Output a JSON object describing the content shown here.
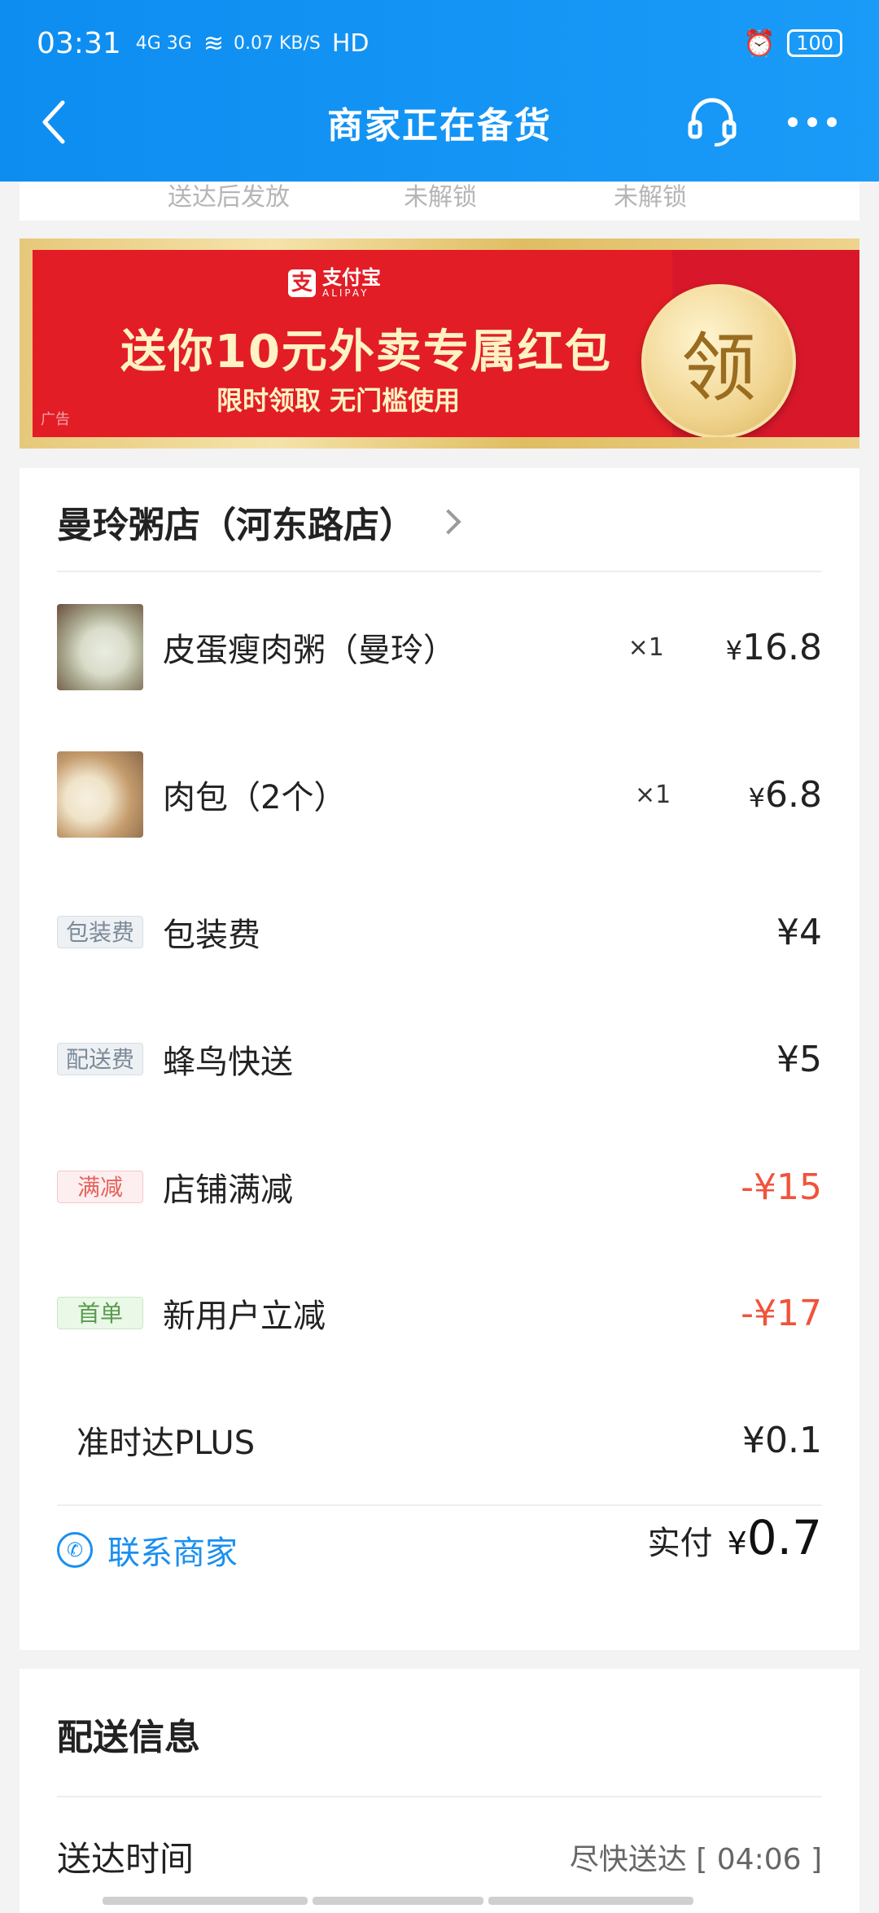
{
  "status_bar": {
    "time": "03:31",
    "signal": "4G 3G",
    "net_speed": "0.07 KB/S",
    "hd": "HD",
    "battery": "100"
  },
  "nav": {
    "title": "商家正在备货"
  },
  "unlock_strip": {
    "items": [
      "送达后发放",
      "未解锁",
      "未解锁"
    ]
  },
  "ad": {
    "brand": "支付宝",
    "brand_sub": "ALIPAY",
    "headline": "送你10元外卖专属红包",
    "subline": "限时领取 无门槛使用",
    "tag": "广告",
    "coin": "领"
  },
  "order": {
    "shop_name": "曼玲粥店（河东路店）",
    "items": [
      {
        "name": "皮蛋瘦肉粥（曼玲）",
        "qty": "×1",
        "price": "16.8"
      },
      {
        "name": "肉包（2个）",
        "qty": "×1",
        "price": "6.8"
      }
    ],
    "fees": [
      {
        "badge": "包装费",
        "name": "包装费",
        "price": "¥4",
        "style": "gray"
      },
      {
        "badge": "配送费",
        "name": "蜂鸟快送",
        "price": "¥5",
        "style": "gray"
      },
      {
        "badge": "满减",
        "name": "店铺满减",
        "price": "-¥15",
        "style": "red"
      },
      {
        "badge": "首单",
        "name": "新用户立减",
        "price": "-¥17",
        "style": "green"
      }
    ],
    "plus": {
      "name": "准时达PLUS",
      "price": "¥0.1"
    },
    "contact": "联系商家",
    "paid_label": "实付",
    "paid_value": "0.7",
    "yen": "¥"
  },
  "delivery": {
    "title": "配送信息",
    "time_label": "送达时间",
    "time_value": "尽快送达 [ 04:06 ]"
  }
}
